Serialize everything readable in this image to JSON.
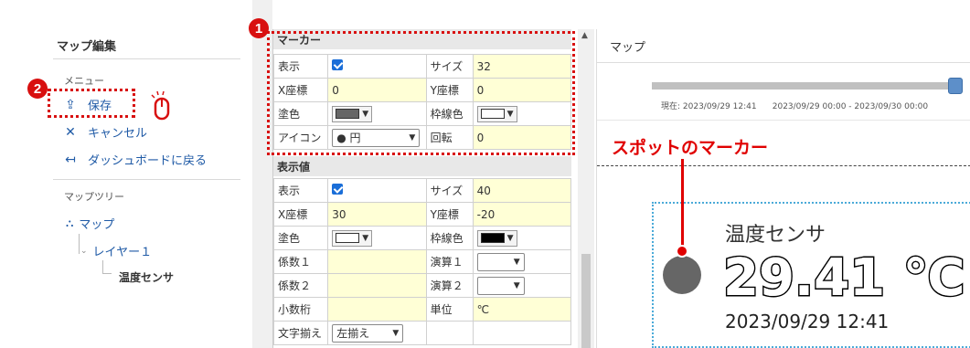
{
  "sidebar": {
    "title": "マップ編集",
    "menu_section": "メニュー",
    "menu_items": [
      {
        "label": "保存",
        "icon": "upload-icon"
      },
      {
        "label": "キャンセル",
        "icon": "close-icon"
      },
      {
        "label": "ダッシュボードに戻る",
        "icon": "arrow-left-icon"
      }
    ],
    "tree_section": "マップツリー",
    "tree": {
      "root": "マップ",
      "layer": "レイヤー１",
      "leaf": "温度センサ"
    }
  },
  "badges": {
    "one": "1",
    "two": "2"
  },
  "marker": {
    "header": "マーカー",
    "show_label": "表示",
    "size_label": "サイズ",
    "size_value": "32",
    "x_label": "X座標",
    "x_value": "0",
    "y_label": "Y座標",
    "y_value": "0",
    "fill_label": "塗色",
    "fill_color": "#666666",
    "stroke_label": "枠線色",
    "stroke_color": "#ffffff",
    "icon_label": "アイコン",
    "icon_value": "● 円",
    "rotate_label": "回転",
    "rotate_value": "0"
  },
  "display_value": {
    "header": "表示値",
    "show_label": "表示",
    "size_label": "サイズ",
    "size_value": "40",
    "x_label": "X座標",
    "x_value": "30",
    "y_label": "Y座標",
    "y_value": "-20",
    "fill_label": "塗色",
    "fill_color": "#ffffff",
    "stroke_label": "枠線色",
    "stroke_color": "#000000",
    "coef1_label": "係数１",
    "calc1_label": "演算１",
    "coef2_label": "係数２",
    "calc2_label": "演算２",
    "decimals_label": "小数桁",
    "unit_label": "単位",
    "unit_value": "℃",
    "align_label": "文字揃え",
    "align_value": "左揃え"
  },
  "map": {
    "title": "マップ",
    "current_time": "現在: 2023/09/29 12:41",
    "range": "2023/09/29 00:00 - 2023/09/30 00:00",
    "slider_fraction": 0.98,
    "annotation": "スポットのマーカー",
    "sensor_name": "温度センサ",
    "value": "29.41 ℃",
    "timestamp": "2023/09/29 12:41"
  },
  "colors": {
    "accent": "#1f5aa6",
    "annotation_red": "#d81010",
    "input_yellow": "#ffffd6"
  }
}
